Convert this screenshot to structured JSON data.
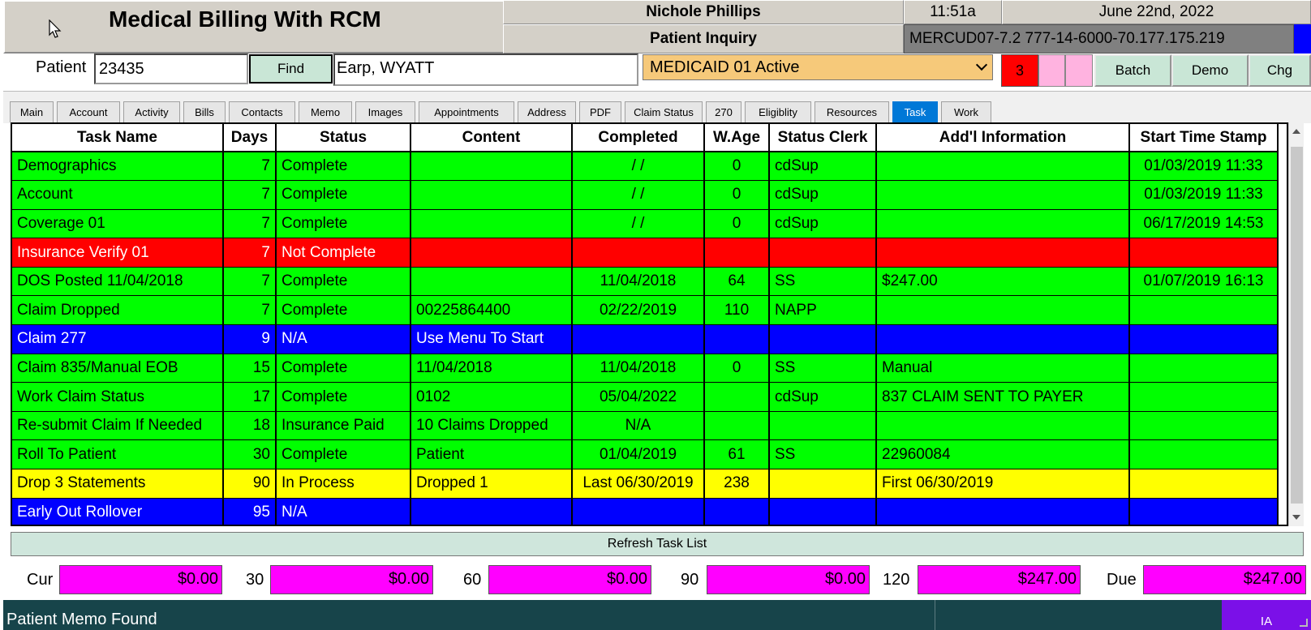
{
  "header": {
    "app_title": "Medical Billing With RCM",
    "user": "Nichole Phillips",
    "time": "11:51a",
    "date": "June 22nd, 2022",
    "screen": "Patient Inquiry",
    "connection": "MERCUD07-7.2 777-14-6000-70.177.175.219"
  },
  "patient": {
    "label": "Patient",
    "id": "23435",
    "find_label": "Find",
    "name": "Earp, WYATT",
    "coverage": "MEDICAID 01 Active",
    "count": "3"
  },
  "actions": {
    "batch": "Batch",
    "demo": "Demo",
    "chg": "Chg"
  },
  "tabs": [
    "Main",
    "Account",
    "Activity",
    "Bills",
    "Contacts",
    "Memo",
    "Images",
    "Appointments",
    "Address",
    "PDF",
    "Claim Status",
    "270",
    "Eligiblity",
    "Resources",
    "Task",
    "Work"
  ],
  "task_table": {
    "headers": [
      "Task Name",
      "Days",
      "Status",
      "Content",
      "Completed",
      "W.Age",
      "Status Clerk",
      "Add'l Information",
      "Start Time Stamp"
    ],
    "rows": [
      {
        "color": "green",
        "cells": [
          "Demographics",
          "7",
          "Complete",
          "",
          "/ /",
          "0",
          "cdSup",
          "",
          "01/03/2019 11:33"
        ]
      },
      {
        "color": "green",
        "cells": [
          "Account",
          "7",
          "Complete",
          "",
          "/ /",
          "0",
          "cdSup",
          "",
          "01/03/2019 11:33"
        ]
      },
      {
        "color": "green",
        "cells": [
          "Coverage 01",
          "7",
          "Complete",
          "",
          "/ /",
          "0",
          "cdSup",
          "",
          "06/17/2019 14:53"
        ]
      },
      {
        "color": "red",
        "cells": [
          "Insurance Verify 01",
          "7",
          "Not Complete",
          "",
          "",
          "",
          "",
          "",
          ""
        ]
      },
      {
        "color": "green",
        "cells": [
          "DOS Posted 11/04/2018",
          "7",
          "Complete",
          "",
          "11/04/2018",
          "64",
          "SS",
          "$247.00",
          "01/07/2019 16:13"
        ]
      },
      {
        "color": "green",
        "cells": [
          "Claim Dropped",
          "7",
          "Complete",
          "00225864400",
          "02/22/2019",
          "110",
          "NAPP",
          "",
          ""
        ]
      },
      {
        "color": "blue",
        "cells": [
          "Claim 277",
          "9",
          "N/A",
          "Use Menu To Start",
          "",
          "",
          "",
          "",
          ""
        ]
      },
      {
        "color": "green",
        "cells": [
          "Claim 835/Manual EOB",
          "15",
          "Complete",
          "11/04/2018",
          "11/04/2018",
          "0",
          "SS",
          "Manual",
          ""
        ]
      },
      {
        "color": "green",
        "cells": [
          "Work Claim Status",
          "17",
          "Complete",
          "0102",
          "05/04/2022",
          "",
          "cdSup",
          "837 CLAIM SENT TO PAYER",
          ""
        ]
      },
      {
        "color": "green",
        "cells": [
          "Re-submit Claim If Needed",
          "18",
          "Insurance Paid",
          "10 Claims Dropped",
          "N/A",
          "",
          "",
          "",
          ""
        ]
      },
      {
        "color": "green",
        "cells": [
          "Roll To Patient",
          "30",
          "Complete",
          "Patient",
          "01/04/2019",
          "61",
          "SS",
          "22960084",
          ""
        ]
      },
      {
        "color": "yellow",
        "cells": [
          "Drop 3 Statements",
          "90",
          "In Process",
          "Dropped 1",
          "Last 06/30/2019",
          "238",
          "",
          "First 06/30/2019",
          ""
        ]
      },
      {
        "color": "blue",
        "cells": [
          "Early Out Rollover",
          "95",
          "N/A",
          "",
          "",
          "",
          "",
          "",
          ""
        ]
      }
    ]
  },
  "refresh_label": "Refresh Task List",
  "aging": [
    {
      "label": "Cur",
      "value": "$0.00"
    },
    {
      "label": "30",
      "value": "$0.00"
    },
    {
      "label": "60",
      "value": "$0.00"
    },
    {
      "label": "90",
      "value": "$0.00"
    },
    {
      "label": "120",
      "value": "$247.00"
    },
    {
      "label": "Due",
      "value": "$247.00"
    }
  ],
  "status_bar": {
    "message": "Patient Memo Found",
    "indicator": "IA"
  },
  "colors": {
    "complete": "#00ff00",
    "not_complete": "#ff0000",
    "na": "#0000ff",
    "in_process": "#ffff00",
    "aging": "#ff00ff",
    "coverage": "#f6c97a"
  }
}
